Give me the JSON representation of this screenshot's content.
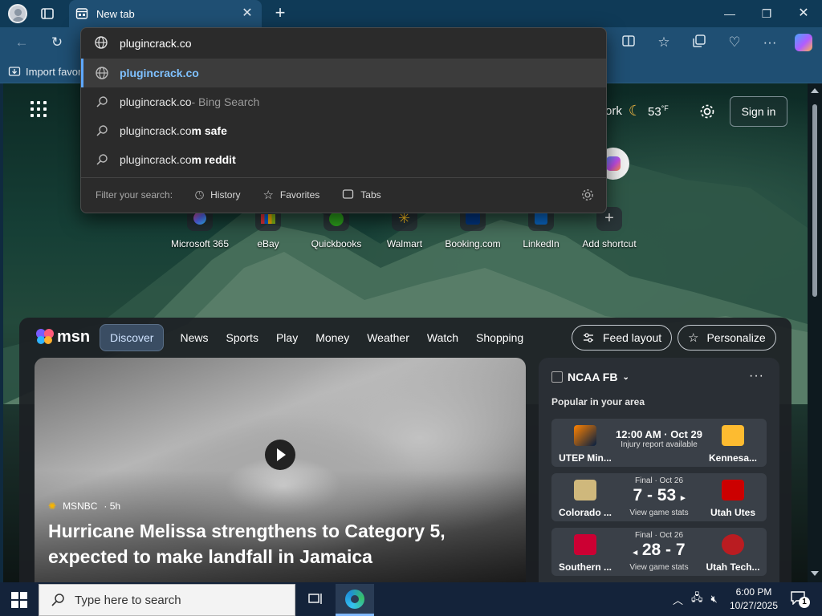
{
  "browser": {
    "tab": {
      "title": "New tab"
    },
    "address": {
      "value": "plugincrack.co"
    },
    "favorites_bar": {
      "import_label": "Import favor"
    }
  },
  "omnibox": {
    "suggestions": [
      {
        "text": "plugincrack.co",
        "suffix": "",
        "icon": "globe-icon"
      },
      {
        "text": "plugincrack.co",
        "suffix": " - Bing Search",
        "icon": "search-icon"
      },
      {
        "text": "plugincrack.co",
        "suffix": "m safe",
        "icon": "search-icon"
      },
      {
        "text": "plugincrack.co",
        "suffix": "m reddit",
        "icon": "search-icon"
      }
    ],
    "filter_label": "Filter your search:",
    "filters": [
      "History",
      "Favorites",
      "Tabs"
    ]
  },
  "newtab": {
    "weather_location": "ork",
    "weather_temp": "53",
    "weather_unit": "°F",
    "sign_in": "Sign in",
    "shortcuts": [
      "Microsoft 365",
      "eBay",
      "Quickbooks",
      "Walmart",
      "Booking.com",
      "LinkedIn",
      "Add shortcut"
    ]
  },
  "feed": {
    "logo": "msn",
    "nav": [
      "Discover",
      "News",
      "Sports",
      "Play",
      "Money",
      "Weather",
      "Watch",
      "Shopping"
    ],
    "feed_layout": "Feed layout",
    "personalize": "Personalize",
    "hero": {
      "source": "MSNBC",
      "age": "· 5h",
      "headline": "Hurricane Melissa strengthens to Category 5, expected to make landfall in Jamaica"
    },
    "sports": {
      "title": "NCAA FB",
      "subtitle": "Popular in your area",
      "games": [
        {
          "team1": "UTEP Min...",
          "team2": "Kennesa...",
          "status": "12:00 AM · Oct 29",
          "score": "",
          "link": "Injury report available"
        },
        {
          "team1": "Colorado ...",
          "team2": "Utah Utes",
          "status": "Final · Oct 26",
          "score": "7 - 53",
          "link": "View game stats"
        },
        {
          "team1": "Southern ...",
          "team2": "Utah Tech...",
          "status": "Final · Oct 26",
          "score": "28 - 7",
          "link": "View game stats"
        }
      ]
    }
  },
  "taskbar": {
    "search_placeholder": "Type here to search",
    "time": "6:00 PM",
    "date": "10/27/2025",
    "notifications": "1"
  },
  "colors": {
    "accent": "#5ea8ff",
    "chrome": "#1f4f73",
    "omnibox_bg": "#2b2b2b"
  }
}
